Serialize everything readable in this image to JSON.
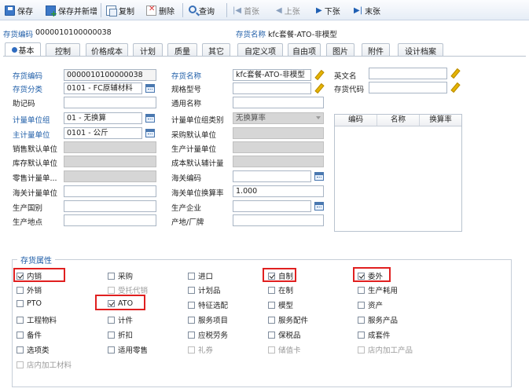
{
  "toolbar": {
    "save": "保存",
    "save_add": "保存并新增",
    "copy": "复制",
    "delete": "删除",
    "query": "查询",
    "first": "首张",
    "prev": "上张",
    "next": "下张",
    "last": "末张"
  },
  "info": {
    "code_label": "存货编码",
    "code_value": "0000010100000038",
    "name_label": "存货名称",
    "name_value": "kfc套餐-ATO-非模型"
  },
  "tabs": [
    "基本",
    "控制",
    "价格成本",
    "计划",
    "质量",
    "其它",
    "自定义项",
    "自由项",
    "图片",
    "附件",
    "设计档案"
  ],
  "form": {
    "col1": [
      {
        "label": "存货编码",
        "value": "0000010100000038"
      },
      {
        "label": "存货分类",
        "value": "0101 - FC原辅材料"
      },
      {
        "label": "助记码",
        "value": ""
      },
      {
        "label": "计量单位组",
        "value": "01 - 无换算"
      },
      {
        "label": "主计量单位",
        "value": "0101 - 公斤"
      },
      {
        "label": "销售默认单位",
        "value": ""
      },
      {
        "label": "库存默认单位",
        "value": ""
      },
      {
        "label": "零售计量单...",
        "value": ""
      },
      {
        "label": "海关计量单位",
        "value": ""
      },
      {
        "label": "生产国别",
        "value": ""
      },
      {
        "label": "生产地点",
        "value": ""
      }
    ],
    "col2": [
      {
        "label": "存货名称",
        "value": "kfc套餐-ATO-非模型"
      },
      {
        "label": "规格型号",
        "value": ""
      },
      {
        "label": "通用名称",
        "value": ""
      },
      {
        "label": "计量单位组类别",
        "value": "无换算率"
      },
      {
        "label": "采购默认单位",
        "value": ""
      },
      {
        "label": "生产计量单位",
        "value": ""
      },
      {
        "label": "成本默认辅计量",
        "value": ""
      },
      {
        "label": "海关编码",
        "value": ""
      },
      {
        "label": "海关单位换算率",
        "value": "1.000"
      },
      {
        "label": "生产企业",
        "value": ""
      },
      {
        "label": "产地/厂牌",
        "value": ""
      }
    ],
    "col3": [
      {
        "label": "英文名",
        "value": ""
      },
      {
        "label": "存货代码",
        "value": ""
      }
    ],
    "table_headers": [
      "编码",
      "名称",
      "换算率"
    ]
  },
  "attributes": {
    "title": "存货属性",
    "items": [
      {
        "label": "内销",
        "checked": true,
        "enabled": true
      },
      {
        "label": "采购",
        "checked": false,
        "enabled": true
      },
      {
        "label": "进口",
        "checked": false,
        "enabled": true
      },
      {
        "label": "自制",
        "checked": true,
        "enabled": true
      },
      {
        "label": "委外",
        "checked": true,
        "enabled": true
      },
      {
        "label": "外销",
        "checked": false,
        "enabled": true
      },
      {
        "label": "受托代销",
        "checked": false,
        "enabled": false
      },
      {
        "label": "计划品",
        "checked": false,
        "enabled": true
      },
      {
        "label": "在制",
        "checked": false,
        "enabled": true
      },
      {
        "label": "生产耗用",
        "checked": false,
        "enabled": true
      },
      {
        "label": "PTO",
        "checked": false,
        "enabled": true
      },
      {
        "label": "ATO",
        "checked": true,
        "enabled": true
      },
      {
        "label": "特征选配",
        "checked": false,
        "enabled": true
      },
      {
        "label": "模型",
        "checked": false,
        "enabled": true
      },
      {
        "label": "资产",
        "checked": false,
        "enabled": true
      },
      {
        "label": "工程物料",
        "checked": false,
        "enabled": true
      },
      {
        "label": "计件",
        "checked": false,
        "enabled": true
      },
      {
        "label": "服务项目",
        "checked": false,
        "enabled": true
      },
      {
        "label": "服务配件",
        "checked": false,
        "enabled": true
      },
      {
        "label": "服务产品",
        "checked": false,
        "enabled": true
      },
      {
        "label": "备件",
        "checked": false,
        "enabled": true
      },
      {
        "label": "折扣",
        "checked": false,
        "enabled": true
      },
      {
        "label": "应税劳务",
        "checked": false,
        "enabled": true
      },
      {
        "label": "保税品",
        "checked": false,
        "enabled": true
      },
      {
        "label": "成套件",
        "checked": false,
        "enabled": true
      },
      {
        "label": "选项类",
        "checked": false,
        "enabled": true
      },
      {
        "label": "适用零售",
        "checked": false,
        "enabled": true
      },
      {
        "label": "礼券",
        "checked": false,
        "enabled": false
      },
      {
        "label": "储值卡",
        "checked": false,
        "enabled": false
      },
      {
        "label": "店内加工产品",
        "checked": false,
        "enabled": false
      },
      {
        "label": "店内加工材料",
        "checked": false,
        "enabled": false
      }
    ]
  }
}
